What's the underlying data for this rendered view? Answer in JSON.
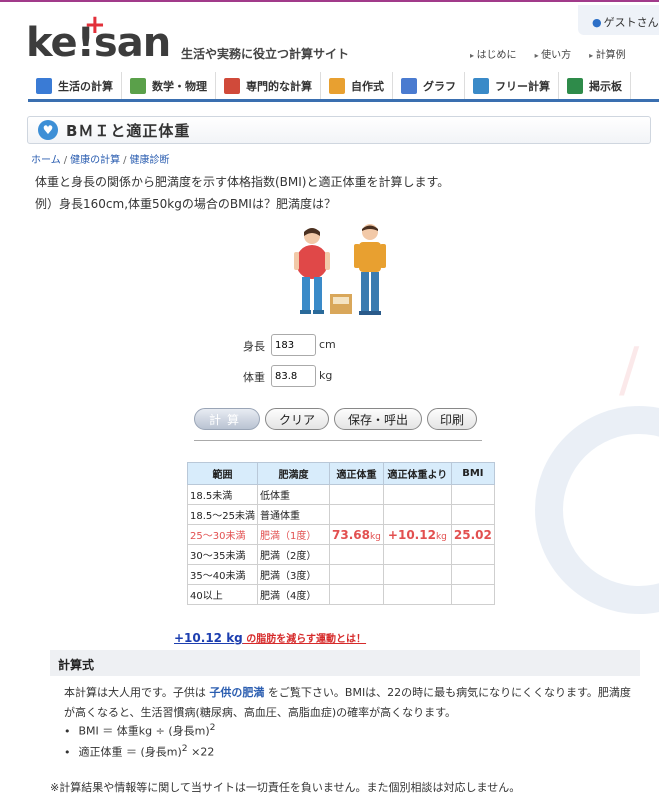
{
  "header": {
    "logo": "ke!san",
    "tagline": "生活や実務に役立つ計算サイト",
    "guest": "ゲストさん",
    "links": [
      "はじめに",
      "使い方",
      "計算例"
    ]
  },
  "nav": [
    {
      "label": "生活の計算",
      "icon": "calculator-icon",
      "color": "#3a7bd5"
    },
    {
      "label": "数学・物理",
      "icon": "triangle-ruler-icon",
      "color": "#5aa04a"
    },
    {
      "label": "専門的な計算",
      "icon": "book-icon",
      "color": "#d04a3a"
    },
    {
      "label": "自作式",
      "icon": "people-icon",
      "color": "#e8a030"
    },
    {
      "label": "グラフ",
      "icon": "bar-chart-icon",
      "color": "#4a7bd0"
    },
    {
      "label": "フリー計算",
      "icon": "pencil-note-icon",
      "color": "#3a8ac8"
    },
    {
      "label": "掲示板",
      "icon": "board-icon",
      "color": "#2e8b4a"
    }
  ],
  "page": {
    "title": "BＭＩと適正体重",
    "breadcrumb": [
      "ホーム",
      "健康の計算",
      "健康診断"
    ],
    "desc1": "体重と身長の関係から肥満度を示す体格指数(BMI)と適正体重を計算します。",
    "desc2": "例）身長160cm,体重50kgの場合のBMIは？肥満度は？"
  },
  "form": {
    "height_label": "身長",
    "height_value": "183",
    "height_unit": "cm",
    "weight_label": "体重",
    "weight_value": "83.8",
    "weight_unit": "kg"
  },
  "buttons": {
    "calc": "計算",
    "clear": "クリア",
    "save": "保存・呼出",
    "print": "印刷"
  },
  "table": {
    "headers": [
      "範囲",
      "肥満度",
      "適正体重",
      "適正体重より",
      "BMI"
    ],
    "rows": [
      {
        "range": "18.5未満",
        "level": "低体重"
      },
      {
        "range": "18.5〜25未満",
        "level": "普通体重"
      },
      {
        "range": "25〜30未満",
        "level": "肥満（1度）"
      },
      {
        "range": "30〜35未満",
        "level": "肥満（2度）"
      },
      {
        "range": "35〜40未満",
        "level": "肥満（3度）"
      },
      {
        "range": "40以上",
        "level": "肥満（4度）"
      }
    ],
    "result": {
      "ideal_weight": "73.68",
      "ideal_unit": "kg",
      "diff": "+10.12",
      "diff_unit": "kg",
      "bmi": "25.02"
    }
  },
  "advice": {
    "value": "+10.12 kg",
    "text": " の脂肪を減らす運動とは！"
  },
  "formula": {
    "heading": "計算式",
    "line1a": "本計算は大人用です。子供は ",
    "link": "子供の肥満",
    "line1b": " をご覧下さい。BMIは、22の時に最も病気になりにくくなります。肥満度が高くなると、生活習慣病(糖尿病、高血圧、高脂血症)の確率が高くなります。",
    "bmi_formula": "BMI ＝ 体重kg ÷ (身長m)",
    "bmi_sup": "2",
    "ideal_formula": "適正体重 ＝ (身長m)",
    "ideal_sup": "2",
    "ideal_tail": " ×22"
  },
  "disclaimer": "※計算結果や情報等に関して当サイトは一切責任を負いません。また個別相談は対応しません。"
}
